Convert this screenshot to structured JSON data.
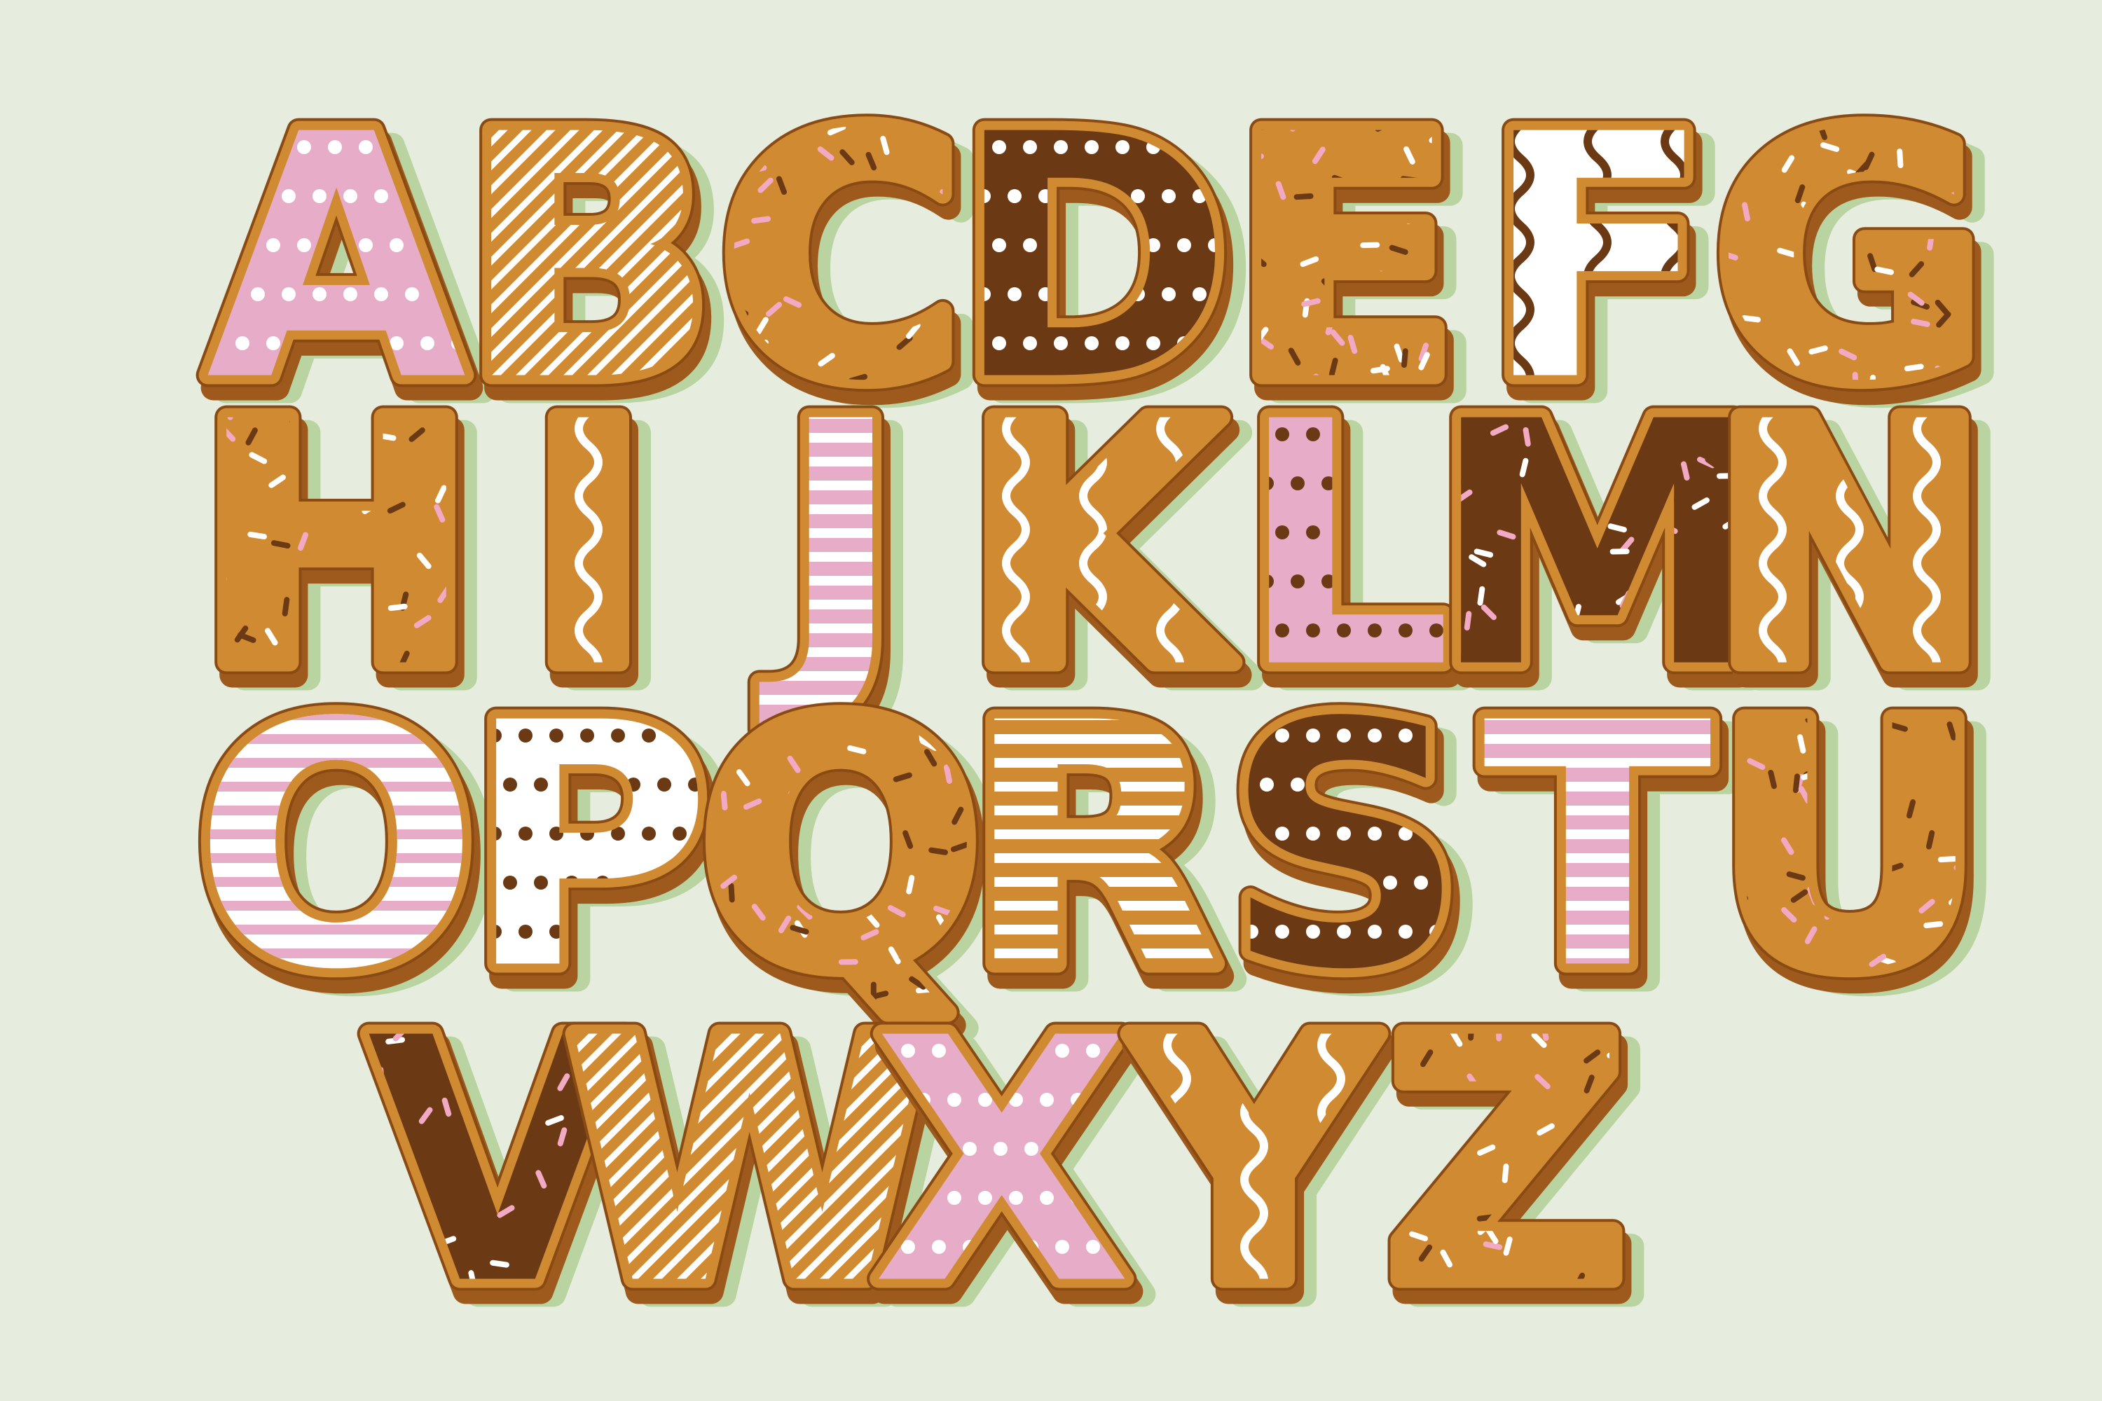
{
  "background_color": "#e6eddf",
  "colors": {
    "cookie": "#d08a31",
    "cookie_side": "#9e5a1c",
    "outline": "#8a4a14",
    "shadow": "#b9d3a1",
    "pink": "#e6acc8",
    "chocolate": "#6b3a14",
    "white": "#ffffff",
    "sprinkle_pink": "#f2a9c4",
    "sprinkle_brown": "#6b3a14"
  },
  "rows": [
    [
      {
        "letter": "A",
        "icing": "pink",
        "deco": "dots"
      },
      {
        "letter": "B",
        "icing": "none",
        "deco": "stripes"
      },
      {
        "letter": "C",
        "icing": "none",
        "deco": "sprinkles"
      },
      {
        "letter": "D",
        "icing": "chocolate",
        "deco": "dots"
      },
      {
        "letter": "E",
        "icing": "none",
        "deco": "sprinkles"
      },
      {
        "letter": "F",
        "icing": "white",
        "deco": "chocowave"
      },
      {
        "letter": "G",
        "icing": "none",
        "deco": "sprinkles"
      }
    ],
    [
      {
        "letter": "H",
        "icing": "none",
        "deco": "sprinkles"
      },
      {
        "letter": "I",
        "icing": "none",
        "deco": "wave"
      },
      {
        "letter": "J",
        "icing": "pink",
        "deco": "bars"
      },
      {
        "letter": "K",
        "icing": "none",
        "deco": "wave"
      },
      {
        "letter": "L",
        "icing": "pink",
        "deco": "browndots"
      },
      {
        "letter": "M",
        "icing": "chocolate",
        "deco": "sprinkles"
      },
      {
        "letter": "N",
        "icing": "none",
        "deco": "wave"
      }
    ],
    [
      {
        "letter": "O",
        "icing": "white",
        "deco": "pinkbars"
      },
      {
        "letter": "P",
        "icing": "white",
        "deco": "browndots"
      },
      {
        "letter": "Q",
        "icing": "none",
        "deco": "sprinkles"
      },
      {
        "letter": "R",
        "icing": "none",
        "deco": "bars"
      },
      {
        "letter": "S",
        "icing": "chocolate",
        "deco": "dots"
      },
      {
        "letter": "T",
        "icing": "pink",
        "deco": "bars"
      },
      {
        "letter": "U",
        "icing": "none",
        "deco": "sprinkles"
      }
    ],
    [
      {
        "letter": "V",
        "icing": "chocolate",
        "deco": "sprinkles"
      },
      {
        "letter": "W",
        "icing": "none",
        "deco": "stripes"
      },
      {
        "letter": "X",
        "icing": "pink",
        "deco": "dots"
      },
      {
        "letter": "Y",
        "icing": "none",
        "deco": "wave"
      },
      {
        "letter": "Z",
        "icing": "none",
        "deco": "sprinkles"
      }
    ]
  ]
}
